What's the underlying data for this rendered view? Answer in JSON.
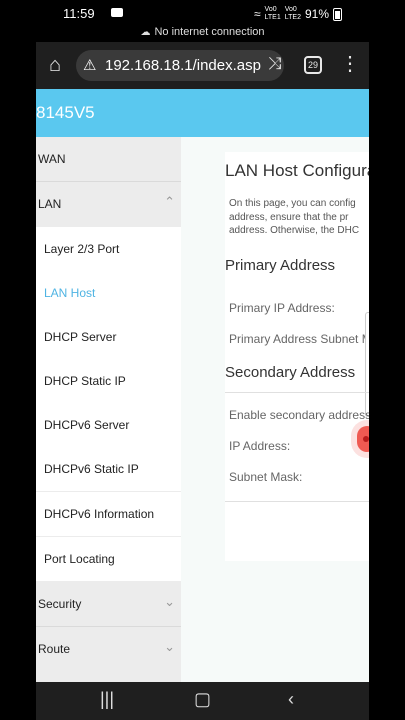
{
  "status": {
    "time": "11:59",
    "signal": "Vo0 LTE1 Vo0 LTE2",
    "battery": "91%",
    "network_notice": "No internet connection"
  },
  "browser": {
    "url": "192.168.18.1/index.asp",
    "tab_count": "29"
  },
  "router": {
    "model": "8145V5"
  },
  "sidebar": {
    "items": [
      {
        "label": "WAN"
      },
      {
        "label": "LAN",
        "expanded": true
      }
    ],
    "lan_sub": [
      {
        "label": "Layer 2/3 Port"
      },
      {
        "label": "LAN Host",
        "active": true
      },
      {
        "label": "DHCP Server"
      },
      {
        "label": "DHCP Static IP"
      },
      {
        "label": "DHCPv6 Server"
      },
      {
        "label": "DHCPv6 Static IP"
      },
      {
        "label": "DHCPv6 Information"
      },
      {
        "label": "Port Locating"
      }
    ],
    "bottom": [
      {
        "label": "Security"
      },
      {
        "label": "Route"
      }
    ]
  },
  "main": {
    "title": "LAN Host Configuration",
    "desc_line1": "On this page, you can config",
    "desc_line2": "address, ensure that the pr",
    "desc_line3": "address. Otherwise, the DHC",
    "primary": {
      "heading": "Primary Address",
      "ip_label": "Primary IP Address:",
      "mask_label": "Primary Address Subnet M"
    },
    "secondary": {
      "heading": "Secondary Address",
      "enable_label": "Enable secondary address",
      "ip_label": "IP Address:",
      "mask_label": "Subnet Mask:"
    }
  },
  "colors": {
    "accent": "#5ac8ef",
    "active_link": "#4fb4e3",
    "toggle": "#ef5a52"
  }
}
